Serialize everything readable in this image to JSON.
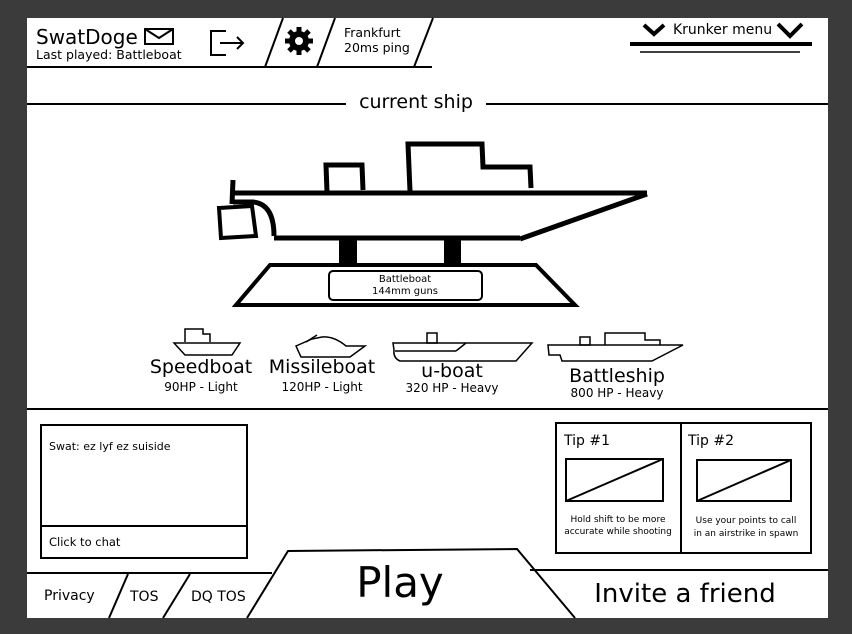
{
  "header": {
    "username": "SwatDoge",
    "last_played": "Last played: Battleboat",
    "mail_icon": "envelope-icon",
    "logout_icon": "logout-icon",
    "settings_icon": "gear-icon",
    "server": "Frankfurt",
    "ping": "20ms ping",
    "menu_label": "Krunker menu",
    "menu_icon": "chevron-down-icon"
  },
  "current_ship": {
    "section_title": "current ship",
    "name": "Battleboat",
    "detail": "144mm guns"
  },
  "ships": [
    {
      "name": "Speedboat",
      "stats": "90HP - Light"
    },
    {
      "name": "Missileboat",
      "stats": "120HP - Light"
    },
    {
      "name": "u-boat",
      "stats": "320 HP - Heavy"
    },
    {
      "name": "Battleship",
      "stats": "800 HP - Heavy"
    }
  ],
  "chat": {
    "messages": [
      "Swat: ez lyf ez suiside"
    ],
    "input_placeholder": "Click to chat"
  },
  "tips": [
    {
      "title": "Tip #1",
      "text_line1": "Hold shift to be more",
      "text_line2": "accurate while shooting"
    },
    {
      "title": "Tip #2",
      "text_line1": "Use your points to call",
      "text_line2": "in an airstrike in spawn"
    }
  ],
  "footer": {
    "privacy": "Privacy",
    "tos": "TOS",
    "dq_tos": "DQ TOS",
    "play": "Play",
    "invite": "Invite a friend"
  }
}
